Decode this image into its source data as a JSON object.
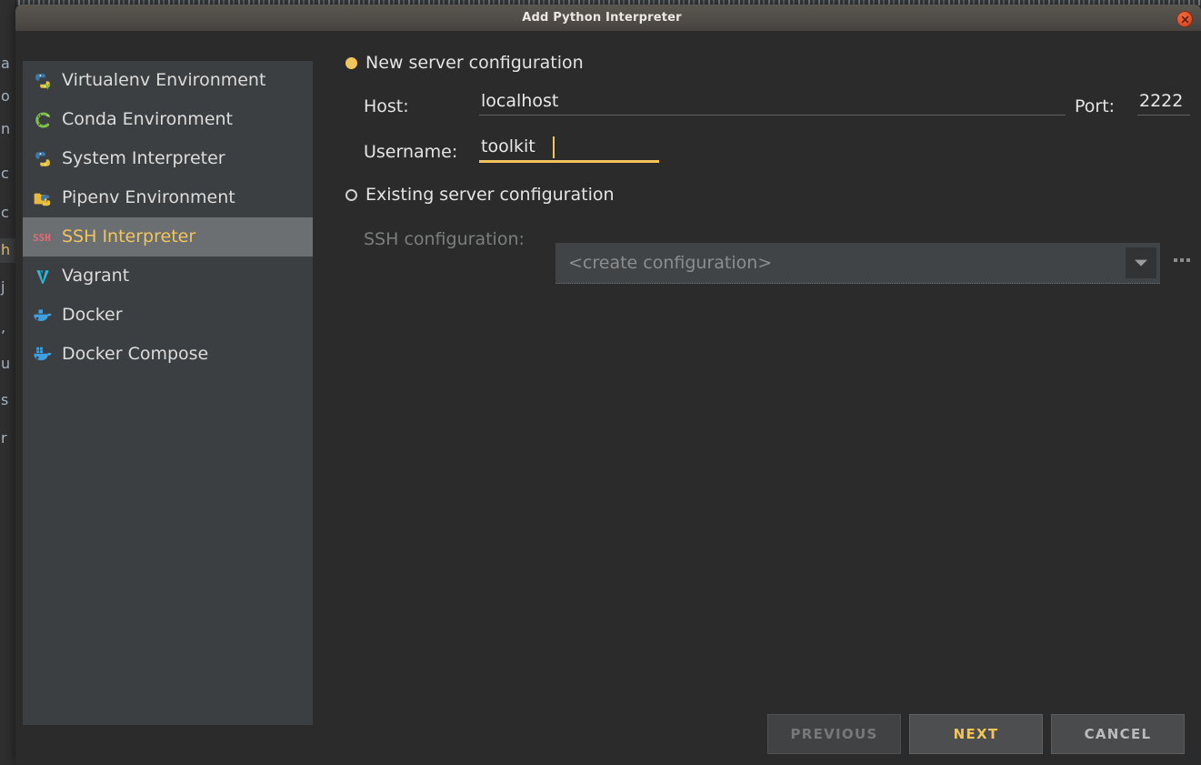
{
  "window": {
    "title": "Add Python Interpreter",
    "close_icon": "close-icon"
  },
  "background": {
    "left_column_letters": [
      "a",
      "o",
      "n",
      "c",
      "c",
      "h",
      "j",
      ",",
      "u",
      "s",
      "r"
    ]
  },
  "sidebar": {
    "items": [
      {
        "label": "Virtualenv Environment",
        "icon": "python-virtualenv-icon",
        "selected": false
      },
      {
        "label": "Conda Environment",
        "icon": "conda-icon",
        "selected": false
      },
      {
        "label": "System Interpreter",
        "icon": "python-icon",
        "selected": false
      },
      {
        "label": "Pipenv Environment",
        "icon": "pipenv-folder-icon",
        "selected": false
      },
      {
        "label": "SSH Interpreter",
        "icon": "ssh-icon",
        "selected": true
      },
      {
        "label": "Vagrant",
        "icon": "vagrant-icon",
        "selected": false
      },
      {
        "label": "Docker",
        "icon": "docker-icon",
        "selected": false
      },
      {
        "label": "Docker Compose",
        "icon": "docker-compose-icon",
        "selected": false
      }
    ]
  },
  "form": {
    "new_server": {
      "radio_label": "New server configuration",
      "selected": true,
      "host_label": "Host:",
      "host_value": "localhost",
      "port_label": "Port:",
      "port_value": "2222",
      "username_label": "Username:",
      "username_value": "toolkit",
      "username_focused": true
    },
    "existing_server": {
      "radio_label": "Existing server configuration",
      "selected": false,
      "ssh_config_label": "SSH configuration:",
      "ssh_config_value": "<create configuration>",
      "dropdown_icon": "chevron-down-icon",
      "browse_icon": "ellipsis-icon"
    }
  },
  "footer": {
    "previous_label": "PREVIOUS",
    "previous_enabled": false,
    "next_label": "NEXT",
    "next_is_default": true,
    "cancel_label": "CANCEL"
  },
  "colors": {
    "accent": "#f2c55c",
    "dialog_bg": "#2b2b2b",
    "panel_bg": "#3c3f41",
    "selected_row": "#6b6f71",
    "close_button": "#e0512b",
    "text": "#e4e4e4",
    "disabled_text": "#7b7d7e"
  }
}
